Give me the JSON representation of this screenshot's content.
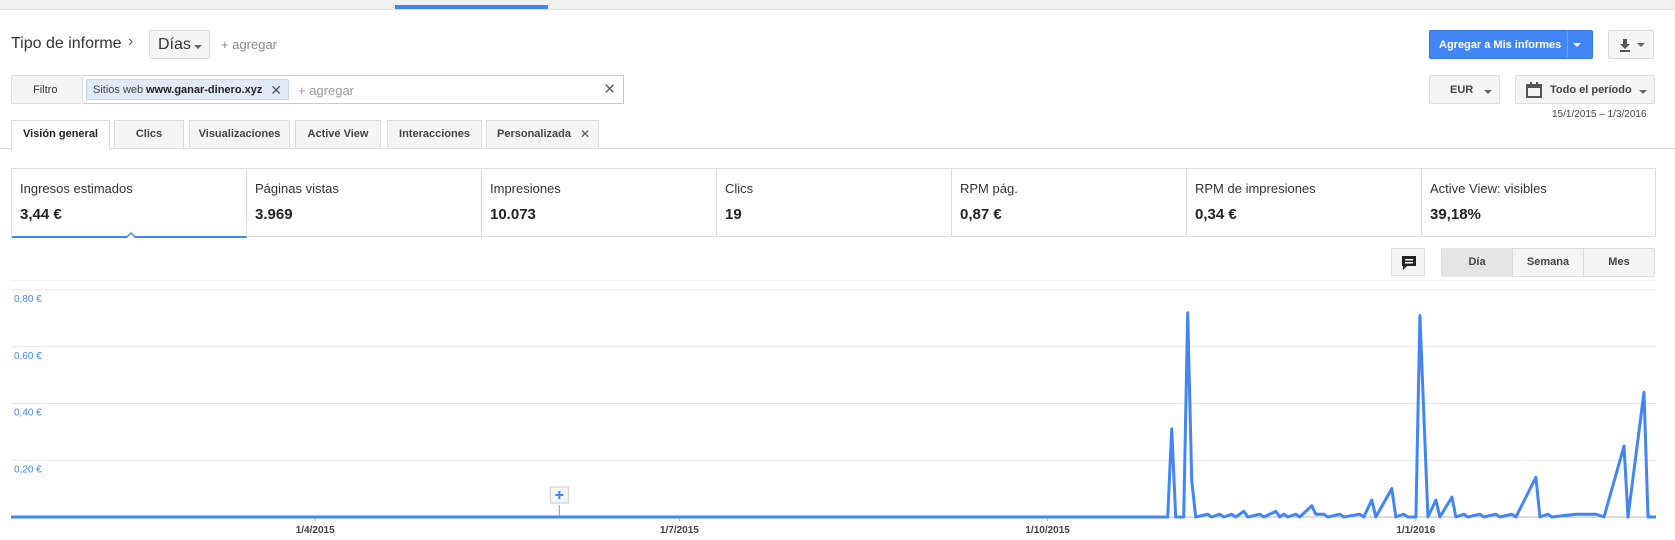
{
  "header": {
    "report_type_label": "Tipo de informe",
    "breadcrumb_sep": "›",
    "dimension": "Días",
    "add_dimension": "+ agregar",
    "add_to_reports": "Agregar a Mis informes"
  },
  "filter": {
    "button": "Filtro",
    "chip_key": "Sitios web",
    "chip_value": "www.ganar-dinero.xyz",
    "chip_remove": "✕",
    "add_placeholder": "+ agregar",
    "clear": "✕"
  },
  "currency": "EUR",
  "date_range": {
    "label": "Todo el período",
    "dates": "15/1/2015 – 1/3/2016"
  },
  "tabs": [
    {
      "label": "Visión general",
      "active": true
    },
    {
      "label": "Clics"
    },
    {
      "label": "Visualizaciones"
    },
    {
      "label": "Active View"
    },
    {
      "label": "Interacciones"
    },
    {
      "label": "Personalizada",
      "closable": true,
      "close": "✕"
    }
  ],
  "metrics": [
    {
      "label": "Ingresos estimados",
      "value": "3,44 €",
      "selected": true
    },
    {
      "label": "Páginas vistas",
      "value": "3.969"
    },
    {
      "label": "Impresiones",
      "value": "10.073"
    },
    {
      "label": "Clics",
      "value": "19"
    },
    {
      "label": "RPM pág.",
      "value": "0,87 €"
    },
    {
      "label": "RPM de impresiones",
      "value": "0,34 €"
    },
    {
      "label": "Active View: visibles",
      "value": "39,18%"
    }
  ],
  "granularity": {
    "day": "Día",
    "week": "Semana",
    "month": "Mes",
    "selected": "Día"
  },
  "icons": {
    "comment": "comment-icon",
    "download": "download-icon",
    "calendar": "calendar-icon",
    "annotation": "add-annotation-icon"
  },
  "colors": {
    "accent": "#4285f4",
    "line": "#4285f4"
  },
  "chart_data": {
    "type": "line",
    "y_ticks": [
      "0,80 €",
      "0,60 €",
      "0,40 €",
      "0,20 €"
    ],
    "y_values": [
      0.8,
      0.6,
      0.4,
      0.2
    ],
    "ylim": [
      0,
      0.8
    ],
    "x_ticks": [
      "1/4/2015",
      "1/7/2015",
      "1/10/2015",
      "1/1/2016"
    ],
    "x_tick_dates": [
      "2015-04-01",
      "2015-07-01",
      "2015-10-01",
      "2016-01-01"
    ],
    "xlim": [
      "2015-01-15",
      "2016-03-01"
    ],
    "annotation_date": "2015-06-01",
    "series": [
      {
        "points": [
          [
            "2015-01-15",
            0
          ],
          [
            "2015-10-31",
            0
          ],
          [
            "2015-11-01",
            0.31
          ],
          [
            "2015-11-02",
            0
          ],
          [
            "2015-11-04",
            0
          ],
          [
            "2015-11-05",
            0.72
          ],
          [
            "2015-11-06",
            0.13
          ],
          [
            "2015-11-07",
            0
          ],
          [
            "2015-11-10",
            0.01
          ],
          [
            "2015-11-11",
            0
          ],
          [
            "2015-11-13",
            0.01
          ],
          [
            "2015-11-14",
            0
          ],
          [
            "2015-11-16",
            0.01
          ],
          [
            "2015-11-17",
            0
          ],
          [
            "2015-11-19",
            0.02
          ],
          [
            "2015-11-20",
            0
          ],
          [
            "2015-11-23",
            0.01
          ],
          [
            "2015-11-24",
            0
          ],
          [
            "2015-11-27",
            0.02
          ],
          [
            "2015-11-28",
            0
          ],
          [
            "2015-11-29",
            0.01
          ],
          [
            "2015-11-30",
            0
          ],
          [
            "2015-12-02",
            0.01
          ],
          [
            "2015-12-03",
            0
          ],
          [
            "2015-12-06",
            0.04
          ],
          [
            "2015-12-07",
            0.01
          ],
          [
            "2015-12-09",
            0.01
          ],
          [
            "2015-12-10",
            0
          ],
          [
            "2015-12-13",
            0.01
          ],
          [
            "2015-12-14",
            0
          ],
          [
            "2015-12-18",
            0.01
          ],
          [
            "2015-12-19",
            0
          ],
          [
            "2015-12-21",
            0.06
          ],
          [
            "2015-12-22",
            0
          ],
          [
            "2015-12-26",
            0.1
          ],
          [
            "2015-12-27",
            0
          ],
          [
            "2015-12-29",
            0.01
          ],
          [
            "2015-12-30",
            0
          ],
          [
            "2016-01-01",
            0
          ],
          [
            "2016-01-02",
            0.71
          ],
          [
            "2016-01-04",
            0
          ],
          [
            "2016-01-06",
            0.06
          ],
          [
            "2016-01-07",
            0
          ],
          [
            "2016-01-10",
            0.07
          ],
          [
            "2016-01-11",
            0
          ],
          [
            "2016-01-13",
            0.01
          ],
          [
            "2016-01-14",
            0
          ],
          [
            "2016-01-17",
            0.01
          ],
          [
            "2016-01-18",
            0
          ],
          [
            "2016-01-21",
            0.01
          ],
          [
            "2016-01-22",
            0
          ],
          [
            "2016-01-25",
            0.01
          ],
          [
            "2016-01-26",
            0
          ],
          [
            "2016-01-31",
            0.14
          ],
          [
            "2016-02-01",
            0
          ],
          [
            "2016-02-03",
            0.01
          ],
          [
            "2016-02-04",
            0
          ],
          [
            "2016-02-10",
            0.01
          ],
          [
            "2016-02-12",
            0.01
          ],
          [
            "2016-02-15",
            0.01
          ],
          [
            "2016-02-17",
            0
          ],
          [
            "2016-02-22",
            0.25
          ],
          [
            "2016-02-23",
            0
          ],
          [
            "2016-02-27",
            0.44
          ],
          [
            "2016-02-28",
            0
          ],
          [
            "2016-03-01",
            0
          ]
        ]
      }
    ]
  }
}
